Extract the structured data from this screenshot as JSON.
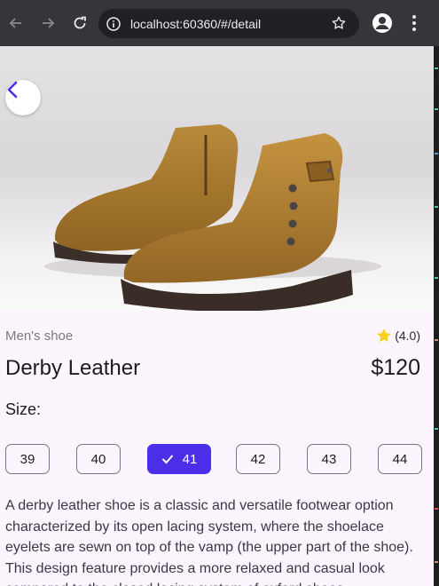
{
  "browser": {
    "url": "localhost:60360/#/detail",
    "icons": [
      "back-arrow-icon",
      "forward-arrow-icon",
      "reload-icon",
      "info-icon",
      "star-icon",
      "profile-icon",
      "kebab-menu-icon"
    ]
  },
  "product": {
    "category": "Men's shoe",
    "rating": "(4.0)",
    "name": "Derby Leather",
    "price": "$120",
    "size_label": "Size:",
    "sizes": [
      "39",
      "40",
      "41",
      "42",
      "43",
      "44"
    ],
    "selected_size": "41",
    "description": "A derby leather shoe is a classic and versatile footwear option characterized by its open lacing system, where the shoelace eyelets are sewn on top of the vamp (the upper part of the shoe). This design feature provides a more relaxed and casual look compared to the closed lacing system of oxford shoes."
  },
  "colors": {
    "accent": "#4a2ee8",
    "background": "#fdf5fe",
    "star": "#f7d21c"
  }
}
